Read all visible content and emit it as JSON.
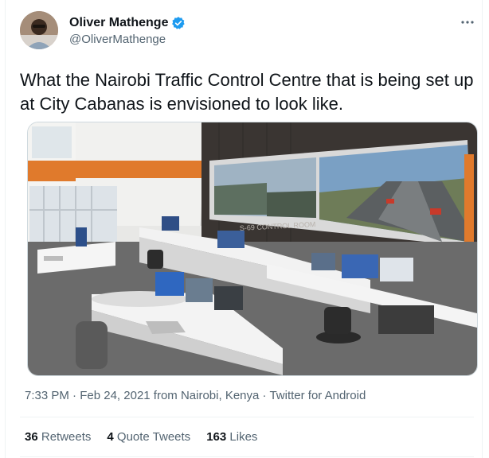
{
  "user": {
    "display_name": "Oliver Mathenge",
    "handle": "@OliverMathenge",
    "verified": true
  },
  "more_icon": "more-horizontal-icon",
  "tweet": {
    "text": "What the Nairobi Traffic Control Centre that is being set up at City Cabanas is envisioned to look like."
  },
  "media": {
    "wall_label": "S-69 CONTROL ROOM"
  },
  "meta": {
    "time": "7:33 PM",
    "date": "Feb 24, 2021",
    "from": "from Nairobi, Kenya",
    "source": "Twitter for Android",
    "sep": "·"
  },
  "stats": {
    "retweets_count": "36",
    "retweets_label": "Retweets",
    "quotes_count": "4",
    "quotes_label": "Quote Tweets",
    "likes_count": "163",
    "likes_label": "Likes"
  },
  "colors": {
    "verified_blue": "#1d9bf0",
    "meta_gray": "#536471",
    "accent_orange": "#e07a2c"
  }
}
